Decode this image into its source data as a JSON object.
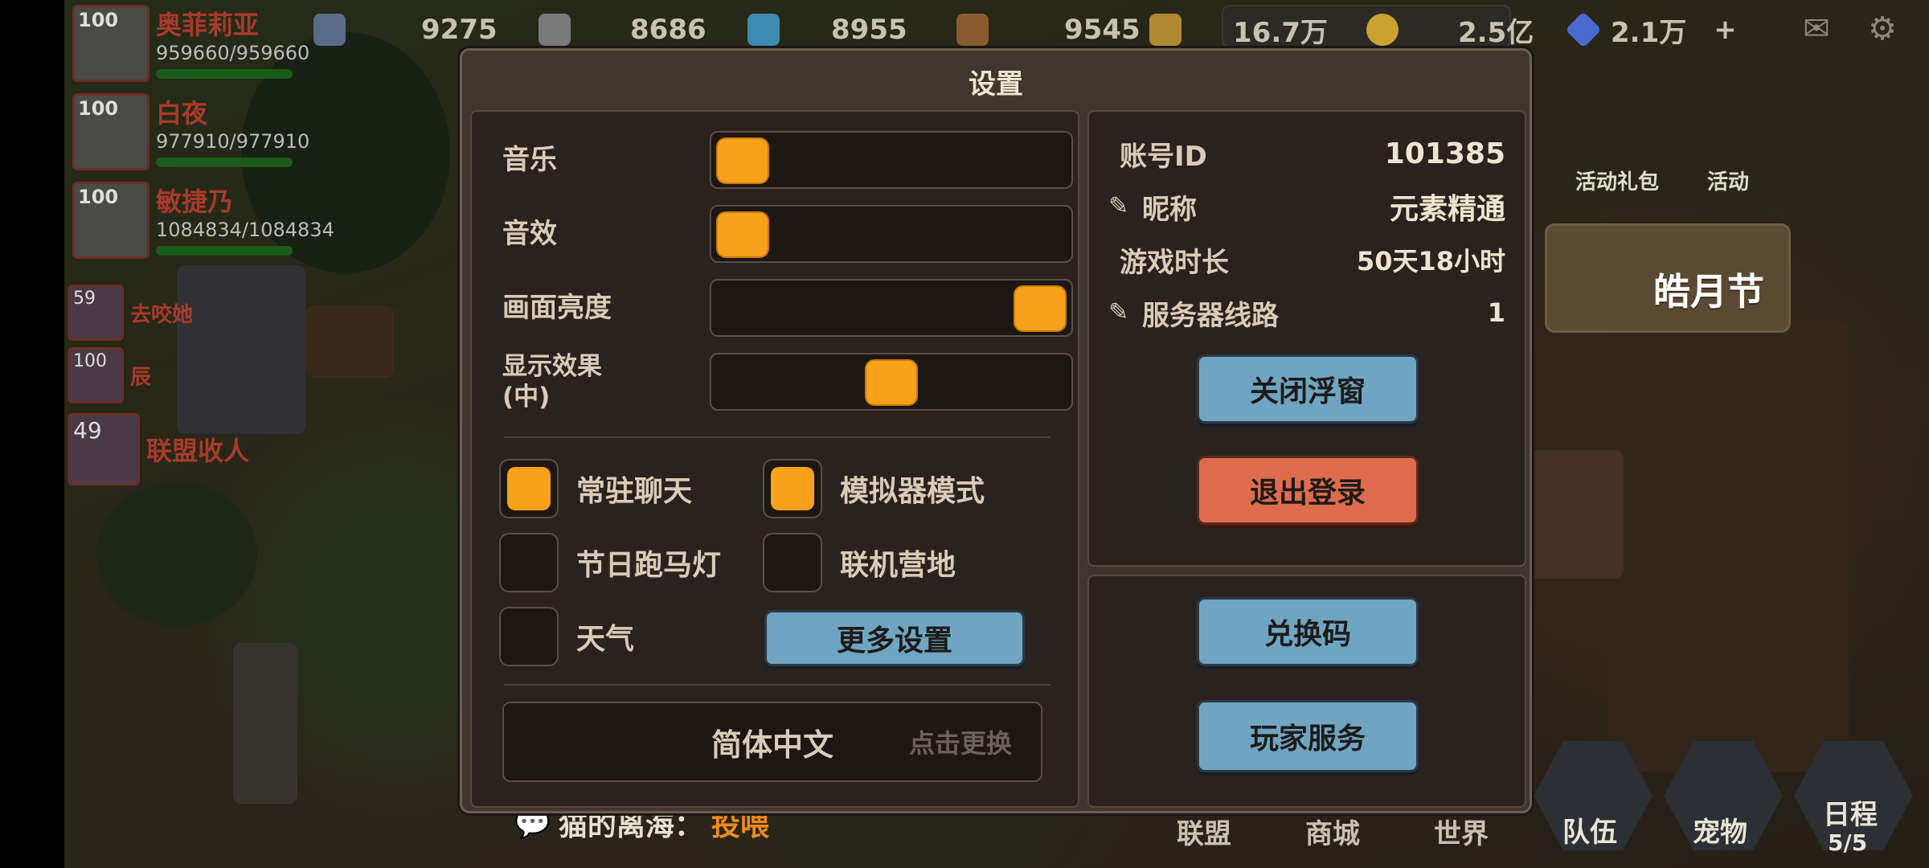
{
  "resources": [
    {
      "icon": "ore-icon",
      "value": "9275"
    },
    {
      "icon": "stone-icon",
      "value": "8686"
    },
    {
      "icon": "crystal-icon",
      "value": "8955"
    },
    {
      "icon": "wood-icon",
      "value": "9545"
    },
    {
      "icon": "wheat-icon",
      "value": "16.7万"
    },
    {
      "icon": "coin-icon",
      "value": "2.5亿"
    },
    {
      "icon": "diamond-icon",
      "value": "2.1万"
    }
  ],
  "party": [
    {
      "level": "100",
      "name": "奥菲莉亚",
      "hp": "959660/959660"
    },
    {
      "level": "100",
      "name": "白夜",
      "hp": "977910/977910"
    },
    {
      "level": "100",
      "name": "敏捷乃",
      "hp": "1084834/1084834"
    }
  ],
  "minions": [
    {
      "level": "59",
      "name": "去咬她"
    },
    {
      "level": "100",
      "name": "辰"
    },
    {
      "level": "49",
      "name": "联盟收人"
    }
  ],
  "top_right": {
    "gift_label": "活动礼包",
    "event_label": "活动",
    "festival_label": "皓月节"
  },
  "settings": {
    "title": "设置",
    "sliders": [
      {
        "label": "音乐",
        "level": 0.0
      },
      {
        "label": "音效",
        "level": 0.0
      },
      {
        "label": "画面亮度",
        "level": 1.0
      },
      {
        "label": "显示效果\n(中)",
        "level": 0.5
      }
    ],
    "toggles": [
      {
        "label": "常驻聊天",
        "checked": true
      },
      {
        "label": "模拟器模式",
        "checked": true
      },
      {
        "label": "节日跑马灯",
        "checked": false
      },
      {
        "label": "联机营地",
        "checked": false
      },
      {
        "label": "天气",
        "checked": false
      }
    ],
    "more_settings_button": "更多设置",
    "language": {
      "value": "简体中文",
      "change_label": "点击更换"
    },
    "account": {
      "id_label": "账号ID",
      "id_value": "101385",
      "nickname_label": "昵称",
      "nickname_value": "元素精通",
      "playtime_label": "游戏时长",
      "playtime_value": "50天18小时",
      "server_label": "服务器线路",
      "server_value": "1"
    },
    "close_float_button": "关闭浮窗",
    "logout_button": "退出登录",
    "redeem_button": "兑换码",
    "service_button": "玩家服务"
  },
  "chat": {
    "speaker": "猫的离海：",
    "message": "投喂"
  },
  "bottom_tabs": [
    "联盟",
    "商城",
    "世界"
  ],
  "bottom_buttons": [
    {
      "label": "队伍"
    },
    {
      "label": "宠物"
    },
    {
      "label": "日程",
      "count": "5/5"
    }
  ],
  "colors": {
    "accent_orange": "#f7a21a",
    "button_blue": "#6fa5c3",
    "button_red": "#de6b4e",
    "panel_bg": "#2a221e"
  }
}
